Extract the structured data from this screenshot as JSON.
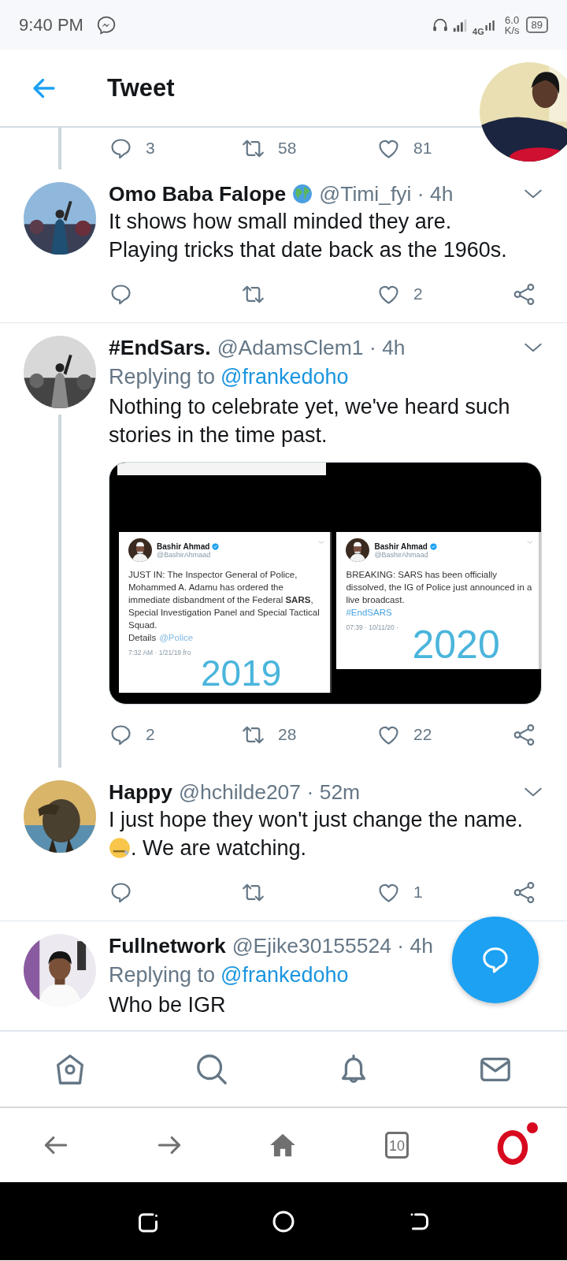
{
  "status_bar": {
    "time": "9:40 PM",
    "network": "4G",
    "speed": "6.0",
    "speed_unit": "K/s",
    "battery": "89"
  },
  "header": {
    "title": "Tweet"
  },
  "previous_tweet": {
    "thread": true,
    "actions": [
      {
        "kind": "reply",
        "count": "3"
      },
      {
        "kind": "retweet",
        "count": "58"
      },
      {
        "kind": "like",
        "count": "81"
      }
    ]
  },
  "tweets": [
    {
      "name": "Omo Baba Falope",
      "name_badge": true,
      "meta": "@Timi_fyi · 4h",
      "menu": true,
      "thread_below": false,
      "body": [
        {
          "kind": "text",
          "text": "It shows how small minded they are."
        },
        {
          "kind": "break"
        },
        {
          "kind": "text",
          "text": "Playing tricks that date back as the 1960s."
        }
      ],
      "actions": [
        {
          "kind": "reply"
        },
        {
          "kind": "retweet"
        },
        {
          "kind": "like",
          "count": "2"
        },
        {
          "kind": "share"
        }
      ]
    },
    {
      "name": "#EndSars.",
      "name_badge": false,
      "meta": "@AdamsClem1 · 4h",
      "menu": true,
      "thread_below": true,
      "replying_to": {
        "label": "Replying to",
        "user": "@frankedoho"
      },
      "body": [
        {
          "kind": "text",
          "text": "Nothing to celebrate yet, we've heard such"
        },
        {
          "kind": "break"
        },
        {
          "kind": "text",
          "text": "stories in the time past."
        }
      ],
      "media": {
        "panels": [
          {
            "author": "Bashir Ahmad",
            "handle": "@BashirAhmaad",
            "text": "JUST IN: The Inspector General of Police, Mohammed A. Adamu has ordered the immediate disbandment of the Federal **SARS**, Special Investigation Panel and Special Tactical Squad.",
            "prefix": "Details",
            "link": "@Police",
            "footer": "7:32 AM · 1/21/19 fro",
            "stamp": "2019"
          },
          {
            "author": "Bashir Ahmad",
            "handle": "@BashirAhmaad",
            "text": "BREAKING: SARS has been officially dissolved, the IG of Police just announced in a live broadcast.",
            "link": "#EndSARS",
            "footer": "07:39 · 10/11/20 ·",
            "stamp": "2020"
          }
        ]
      },
      "actions": [
        {
          "kind": "reply",
          "count": "2"
        },
        {
          "kind": "retweet",
          "count": "28"
        },
        {
          "kind": "like",
          "count": "22"
        },
        {
          "kind": "share"
        }
      ]
    },
    {
      "name": "Happy",
      "name_badge": false,
      "meta": "@hchilde207 · 52m",
      "menu": true,
      "thread_below": false,
      "body": [
        {
          "kind": "text",
          "text": "I just hope they won't just change the name."
        },
        {
          "kind": "break"
        },
        {
          "kind": "emoji"
        },
        {
          "kind": "text",
          "text": ". We are watching."
        }
      ],
      "actions": [
        {
          "kind": "reply"
        },
        {
          "kind": "retweet"
        },
        {
          "kind": "like",
          "count": "1"
        },
        {
          "kind": "share"
        }
      ]
    },
    {
      "name": "Fullnetwork",
      "name_badge": false,
      "meta": "@Ejike30155524 · 4h",
      "menu": false,
      "thread_below": false,
      "replying_to": {
        "label": "Replying to",
        "user": "@frankedoho"
      },
      "body": [
        {
          "kind": "text",
          "text": "Who be IGR"
        }
      ]
    }
  ],
  "tab_count": "10"
}
